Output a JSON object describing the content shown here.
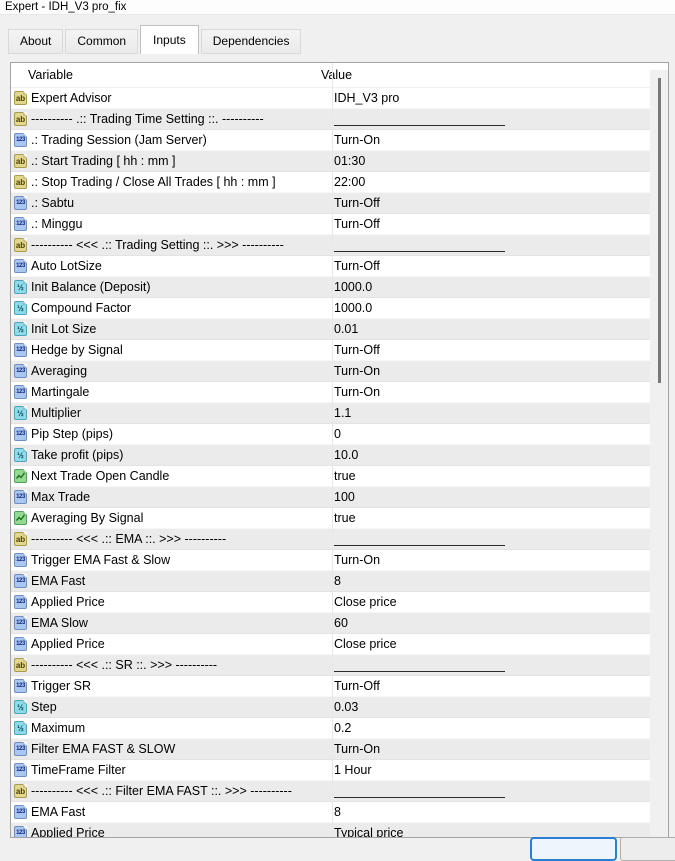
{
  "window": {
    "title": "Expert - IDH_V3 pro_fix"
  },
  "tabs": [
    {
      "label": "About",
      "active": false
    },
    {
      "label": "Common",
      "active": false
    },
    {
      "label": "Inputs",
      "active": true
    },
    {
      "label": "Dependencies",
      "active": false
    }
  ],
  "table": {
    "columns": [
      "Variable",
      "Value"
    ],
    "icon_glyphs": {
      "text": "ab",
      "int": "123",
      "double": "½",
      "bool": ""
    },
    "rows": [
      {
        "type": "text",
        "variable": "Expert Advisor",
        "value": "IDH_V3 pro"
      },
      {
        "type": "text",
        "variable": "---------- .:: Trading Time Setting ::. ----------",
        "value": "",
        "underline": true
      },
      {
        "type": "int",
        "variable": ".: Trading Session (Jam Server)",
        "value": "Turn-On"
      },
      {
        "type": "text",
        "variable": ".: Start Trading [ hh : mm ]",
        "value": "01:30"
      },
      {
        "type": "text",
        "variable": ".: Stop Trading / Close All Trades [ hh : mm ]",
        "value": "22:00"
      },
      {
        "type": "int",
        "variable": ".: Sabtu",
        "value": "Turn-Off"
      },
      {
        "type": "int",
        "variable": ".: Minggu",
        "value": "Turn-Off"
      },
      {
        "type": "text",
        "variable": "---------- <<< .:: Trading Setting ::. >>> ----------",
        "value": "",
        "underline": true
      },
      {
        "type": "int",
        "variable": "Auto LotSize",
        "value": "Turn-Off"
      },
      {
        "type": "double",
        "variable": "Init Balance (Deposit)",
        "value": "1000.0"
      },
      {
        "type": "double",
        "variable": "Compound Factor",
        "value": "1000.0"
      },
      {
        "type": "double",
        "variable": "Init Lot Size",
        "value": "0.01"
      },
      {
        "type": "int",
        "variable": "Hedge by Signal",
        "value": "Turn-Off"
      },
      {
        "type": "int",
        "variable": "Averaging",
        "value": "Turn-On"
      },
      {
        "type": "int",
        "variable": "Martingale",
        "value": "Turn-On"
      },
      {
        "type": "double",
        "variable": "Multiplier",
        "value": "1.1"
      },
      {
        "type": "int",
        "variable": "Pip Step (pips)",
        "value": "0"
      },
      {
        "type": "double",
        "variable": "Take profit (pips)",
        "value": "10.0"
      },
      {
        "type": "bool",
        "variable": "Next Trade Open Candle",
        "value": "true"
      },
      {
        "type": "int",
        "variable": "Max Trade",
        "value": "100"
      },
      {
        "type": "bool",
        "variable": "Averaging By Signal",
        "value": "true"
      },
      {
        "type": "text",
        "variable": "---------- <<< .:: EMA ::. >>> ----------",
        "value": "",
        "underline": true
      },
      {
        "type": "int",
        "variable": "Trigger EMA Fast & Slow",
        "value": "Turn-On"
      },
      {
        "type": "int",
        "variable": "EMA Fast",
        "value": "8"
      },
      {
        "type": "int",
        "variable": "Applied Price",
        "value": "Close price"
      },
      {
        "type": "int",
        "variable": "EMA Slow",
        "value": "60"
      },
      {
        "type": "int",
        "variable": "Applied Price",
        "value": "Close price"
      },
      {
        "type": "text",
        "variable": "---------- <<< .:: SR ::. >>> ----------",
        "value": "",
        "underline": true
      },
      {
        "type": "int",
        "variable": "Trigger SR",
        "value": "Turn-Off"
      },
      {
        "type": "double",
        "variable": "Step",
        "value": "0.03"
      },
      {
        "type": "double",
        "variable": "Maximum",
        "value": "0.2"
      },
      {
        "type": "int",
        "variable": "Filter EMA FAST & SLOW",
        "value": "Turn-On"
      },
      {
        "type": "int",
        "variable": "TimeFrame Filter",
        "value": "1 Hour"
      },
      {
        "type": "text",
        "variable": "---------- <<< .:: Filter EMA FAST ::. >>> ----------",
        "value": "",
        "underline": true
      },
      {
        "type": "int",
        "variable": "EMA Fast",
        "value": "8"
      },
      {
        "type": "int",
        "variable": "Applied Price",
        "value": "Typical price"
      }
    ]
  },
  "footer": {
    "buttons": [
      {
        "label": ""
      },
      {
        "label": ""
      }
    ]
  },
  "colors": {
    "accent_blue": "#2a7fd4",
    "row_alt": "#ebebeb",
    "icon_text_bg": "#e3d68d",
    "icon_int_bg": "#a9c7f1",
    "icon_double_bg": "#8edbe9",
    "icon_bool_bg": "#93da93"
  }
}
